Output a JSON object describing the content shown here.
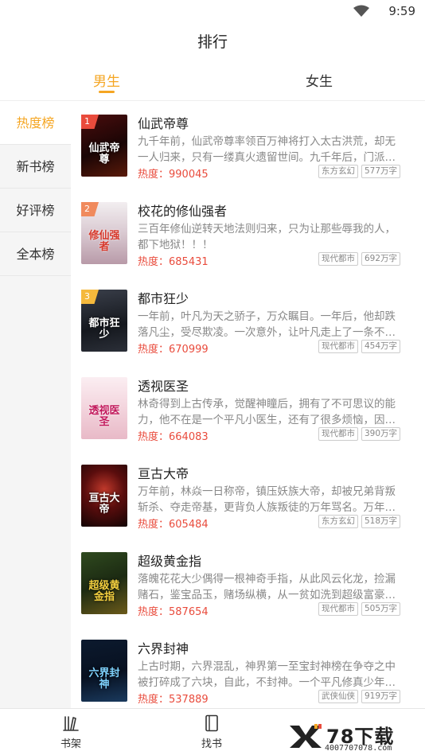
{
  "status_bar": {
    "time": "9:59"
  },
  "header": {
    "title": "排行"
  },
  "gender_tabs": [
    {
      "label": "男生",
      "active": true
    },
    {
      "label": "女生",
      "active": false
    }
  ],
  "sidebar": {
    "items": [
      {
        "label": "热度榜",
        "active": true
      },
      {
        "label": "新书榜",
        "active": false
      },
      {
        "label": "好评榜",
        "active": false
      },
      {
        "label": "全本榜",
        "active": false
      }
    ]
  },
  "books": [
    {
      "rank": "1",
      "title": "仙武帝尊",
      "cover_text": "仙武帝尊",
      "description": "九千年前，仙武帝尊率领百万神将打入太古洪荒，却无一人归来，只有一缕真火遗留世间。九千年后，门派废徒…",
      "heat_label": "热度：",
      "heat_value": "990045",
      "genre": "东方玄幻",
      "word_count": "577万字"
    },
    {
      "rank": "2",
      "title": "校花的修仙强者",
      "cover_text": "修仙强者",
      "description": "三百年修仙逆转天地法则归来，只为让那些辱我的人，都下地狱！！！",
      "heat_label": "热度：",
      "heat_value": "685431",
      "genre": "现代都市",
      "word_count": "692万字"
    },
    {
      "rank": "3",
      "title": "都市狂少",
      "cover_text": "都市狂少",
      "description": "一年前，叶凡为天之骄子，万众瞩目。一年后，他却跌落凡尘，受尽欺凌。一次意外，让叶凡走上了一条不同的…",
      "heat_label": "热度：",
      "heat_value": "670999",
      "genre": "现代都市",
      "word_count": "454万字"
    },
    {
      "rank": "",
      "title": "透视医圣",
      "cover_text": "透视医圣",
      "description": "林奇得到上古传承，觉醒神瞳后，拥有了不可思议的能力，他不在是一个平凡小医生，还有了很多烦恼，因为…",
      "heat_label": "热度：",
      "heat_value": "664083",
      "genre": "现代都市",
      "word_count": "390万字"
    },
    {
      "rank": "",
      "title": "亘古大帝",
      "cover_text": "亘古大帝",
      "description": "万年前，林焱一日称帝，镇压妖族大帝，却被兄弟背叛斩杀、夺走帝基，更背负人族叛徒的万年骂名。万年后，…",
      "heat_label": "热度：",
      "heat_value": "605484",
      "genre": "东方玄幻",
      "word_count": "518万字"
    },
    {
      "rank": "",
      "title": "超级黄金指",
      "cover_text": "超级黄金指",
      "description": "落魄花花大少偶得一根神奇手指，从此风云化龙，捡漏赌石，鉴宝品玉，赌场纵横，从一贫如洗到超级富豪，开…",
      "heat_label": "热度：",
      "heat_value": "587654",
      "genre": "现代都市",
      "word_count": "505万字"
    },
    {
      "rank": "",
      "title": "六界封神",
      "cover_text": "六界封神",
      "description": "上古时期，六界混乱，神界第一至宝封神榜在争夺之中被打碎成了六块，自此，不封神。一个平凡修真少年叶晨…",
      "heat_label": "热度：",
      "heat_value": "537889",
      "genre": "武侠仙侠",
      "word_count": "919万字"
    }
  ],
  "bottom_nav": [
    {
      "label": "书架"
    },
    {
      "label": "找书"
    }
  ],
  "watermark": {
    "name": "78下载",
    "phone": "4007707078.com"
  },
  "colors": {
    "accent": "#f5a623",
    "heat": "#e94b3c",
    "rank1": "#e94b3c",
    "rank2": "#f08a5d",
    "rank3": "#f5b93c"
  }
}
